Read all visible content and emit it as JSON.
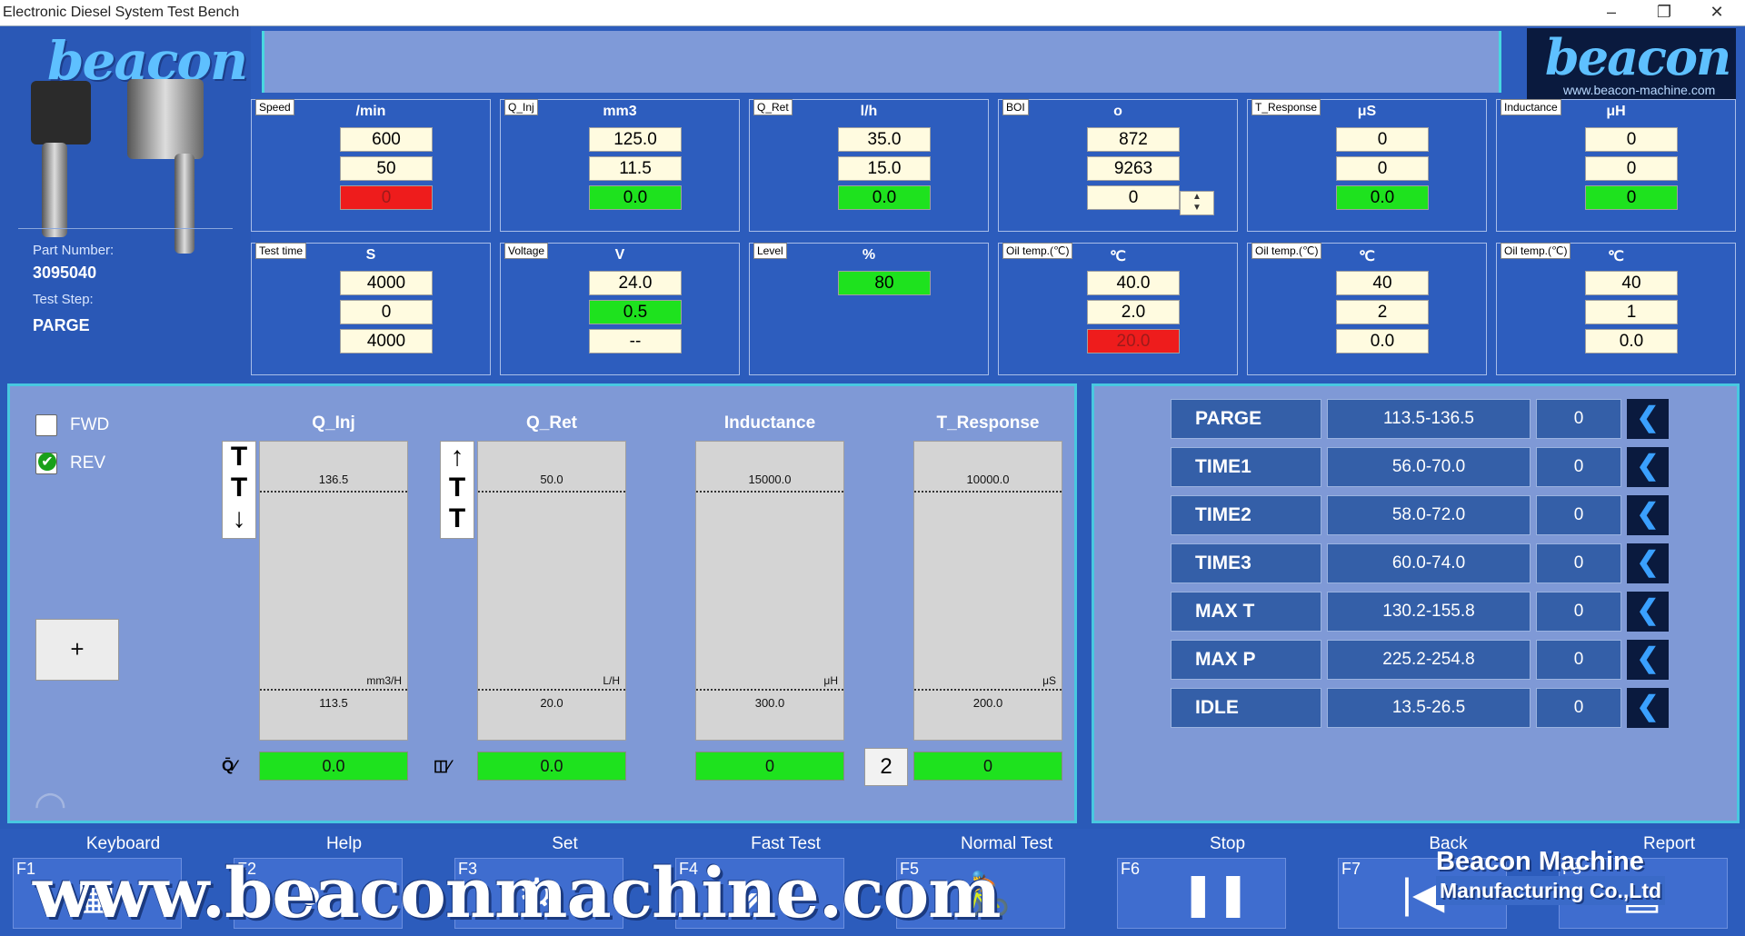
{
  "window": {
    "title": "Electronic Diesel System Test Bench"
  },
  "brand": {
    "name": "beacon",
    "url": "www.beacon-machine.com"
  },
  "part": {
    "part_number_label": "Part Number:",
    "part_number": "3095040",
    "test_step_label": "Test Step:",
    "test_step": "PARGE"
  },
  "panels": [
    {
      "tag": "Speed",
      "unit": "/min",
      "values": [
        "600",
        "50",
        "0"
      ],
      "styles": [
        "",
        "",
        "red"
      ]
    },
    {
      "tag": "Q_Inj",
      "unit": "mm3",
      "values": [
        "125.0",
        "11.5",
        "0.0"
      ],
      "styles": [
        "",
        "",
        "green"
      ]
    },
    {
      "tag": "Q_Ret",
      "unit": "l/h",
      "values": [
        "35.0",
        "15.0",
        "0.0"
      ],
      "styles": [
        "",
        "",
        "green"
      ]
    },
    {
      "tag": "BOI",
      "unit": "o",
      "values": [
        "872",
        "9263",
        "0"
      ],
      "styles": [
        "",
        "",
        ""
      ]
    },
    {
      "tag": "T_Response",
      "unit": "μS",
      "values": [
        "0",
        "0",
        "0.0"
      ],
      "styles": [
        "",
        "",
        "green"
      ]
    },
    {
      "tag": "Inductance",
      "unit": "μH",
      "values": [
        "0",
        "0",
        "0"
      ],
      "styles": [
        "",
        "",
        "green"
      ]
    },
    {
      "tag": "Test time",
      "unit": "S",
      "values": [
        "4000",
        "0",
        "4000"
      ],
      "styles": [
        "",
        "",
        ""
      ]
    },
    {
      "tag": "Voltage",
      "unit": "V",
      "values": [
        "24.0",
        "0.5",
        "--"
      ],
      "styles": [
        "",
        "green",
        ""
      ]
    },
    {
      "tag": "Level",
      "unit": "%",
      "values": [
        "80"
      ],
      "styles": [
        "green"
      ]
    },
    {
      "tag": "Oil temp.(℃)",
      "unit": "℃",
      "values": [
        "40.0",
        "2.0",
        "20.0"
      ],
      "styles": [
        "",
        "",
        "red"
      ]
    },
    {
      "tag": "Oil temp.(℃)",
      "unit": "℃",
      "values": [
        "40",
        "2",
        "0.0"
      ],
      "styles": [
        "",
        "",
        ""
      ]
    },
    {
      "tag": "Oil temp.(℃)",
      "unit": "℃",
      "values": [
        "40",
        "1",
        "0.0"
      ],
      "styles": [
        "",
        "",
        ""
      ]
    }
  ],
  "direction": {
    "fwd": "FWD",
    "rev": "REV",
    "fwd_checked": false,
    "rev_checked": true
  },
  "plus_label": "+",
  "gauges": [
    {
      "title": "Q_Inj",
      "max": "136.5",
      "min": "113.5",
      "unit": "mm3/H",
      "value": "0.0"
    },
    {
      "title": "Q_Ret",
      "max": "50.0",
      "min": "20.0",
      "unit": "L/H",
      "value": "0.0"
    },
    {
      "title": "Inductance",
      "max": "15000.0",
      "min": "300.0",
      "unit": "μH",
      "value": "0"
    },
    {
      "title": "T_Response",
      "max": "10000.0",
      "min": "200.0",
      "unit": "μS",
      "value": "0"
    }
  ],
  "count_box": "2",
  "results": [
    {
      "name": "PARGE",
      "range": "113.5-136.5",
      "value": "0"
    },
    {
      "name": "TIME1",
      "range": "56.0-70.0",
      "value": "0"
    },
    {
      "name": "TIME2",
      "range": "58.0-72.0",
      "value": "0"
    },
    {
      "name": "TIME3",
      "range": "60.0-74.0",
      "value": "0"
    },
    {
      "name": "MAX T",
      "range": "130.2-155.8",
      "value": "0"
    },
    {
      "name": "MAX P",
      "range": "225.2-254.8",
      "value": "0"
    },
    {
      "name": "IDLE",
      "range": "13.5-26.5",
      "value": "0"
    }
  ],
  "fkeys": [
    {
      "key": "F1",
      "label": "Keyboard",
      "icon": "keyboard-icon",
      "glyph": "▦"
    },
    {
      "key": "F2",
      "label": "Help",
      "icon": "help-icon",
      "glyph": "●"
    },
    {
      "key": "F3",
      "label": "Set",
      "icon": "settings-icon",
      "glyph": "⚙"
    },
    {
      "key": "F4",
      "label": "Fast Test",
      "icon": "rocket-icon",
      "glyph": "➶"
    },
    {
      "key": "F5",
      "label": "Normal Test",
      "icon": "cyclist-icon",
      "glyph": "🚴"
    },
    {
      "key": "F6",
      "label": "Stop",
      "icon": "pause-icon",
      "glyph": "❚❚"
    },
    {
      "key": "F7",
      "label": "Back",
      "icon": "back-icon",
      "glyph": "|◀"
    },
    {
      "key": "F8",
      "label": "Report",
      "icon": "report-icon",
      "glyph": "▤"
    }
  ],
  "watermark": {
    "site": "www.beaconmachine.com",
    "company_line1": "Beacon Machine",
    "company_line2": "Manufacturing Co.,Ltd"
  },
  "colors": {
    "green": "#1ee21e",
    "red": "#ee1c1c",
    "frame": "#48c8e0"
  }
}
